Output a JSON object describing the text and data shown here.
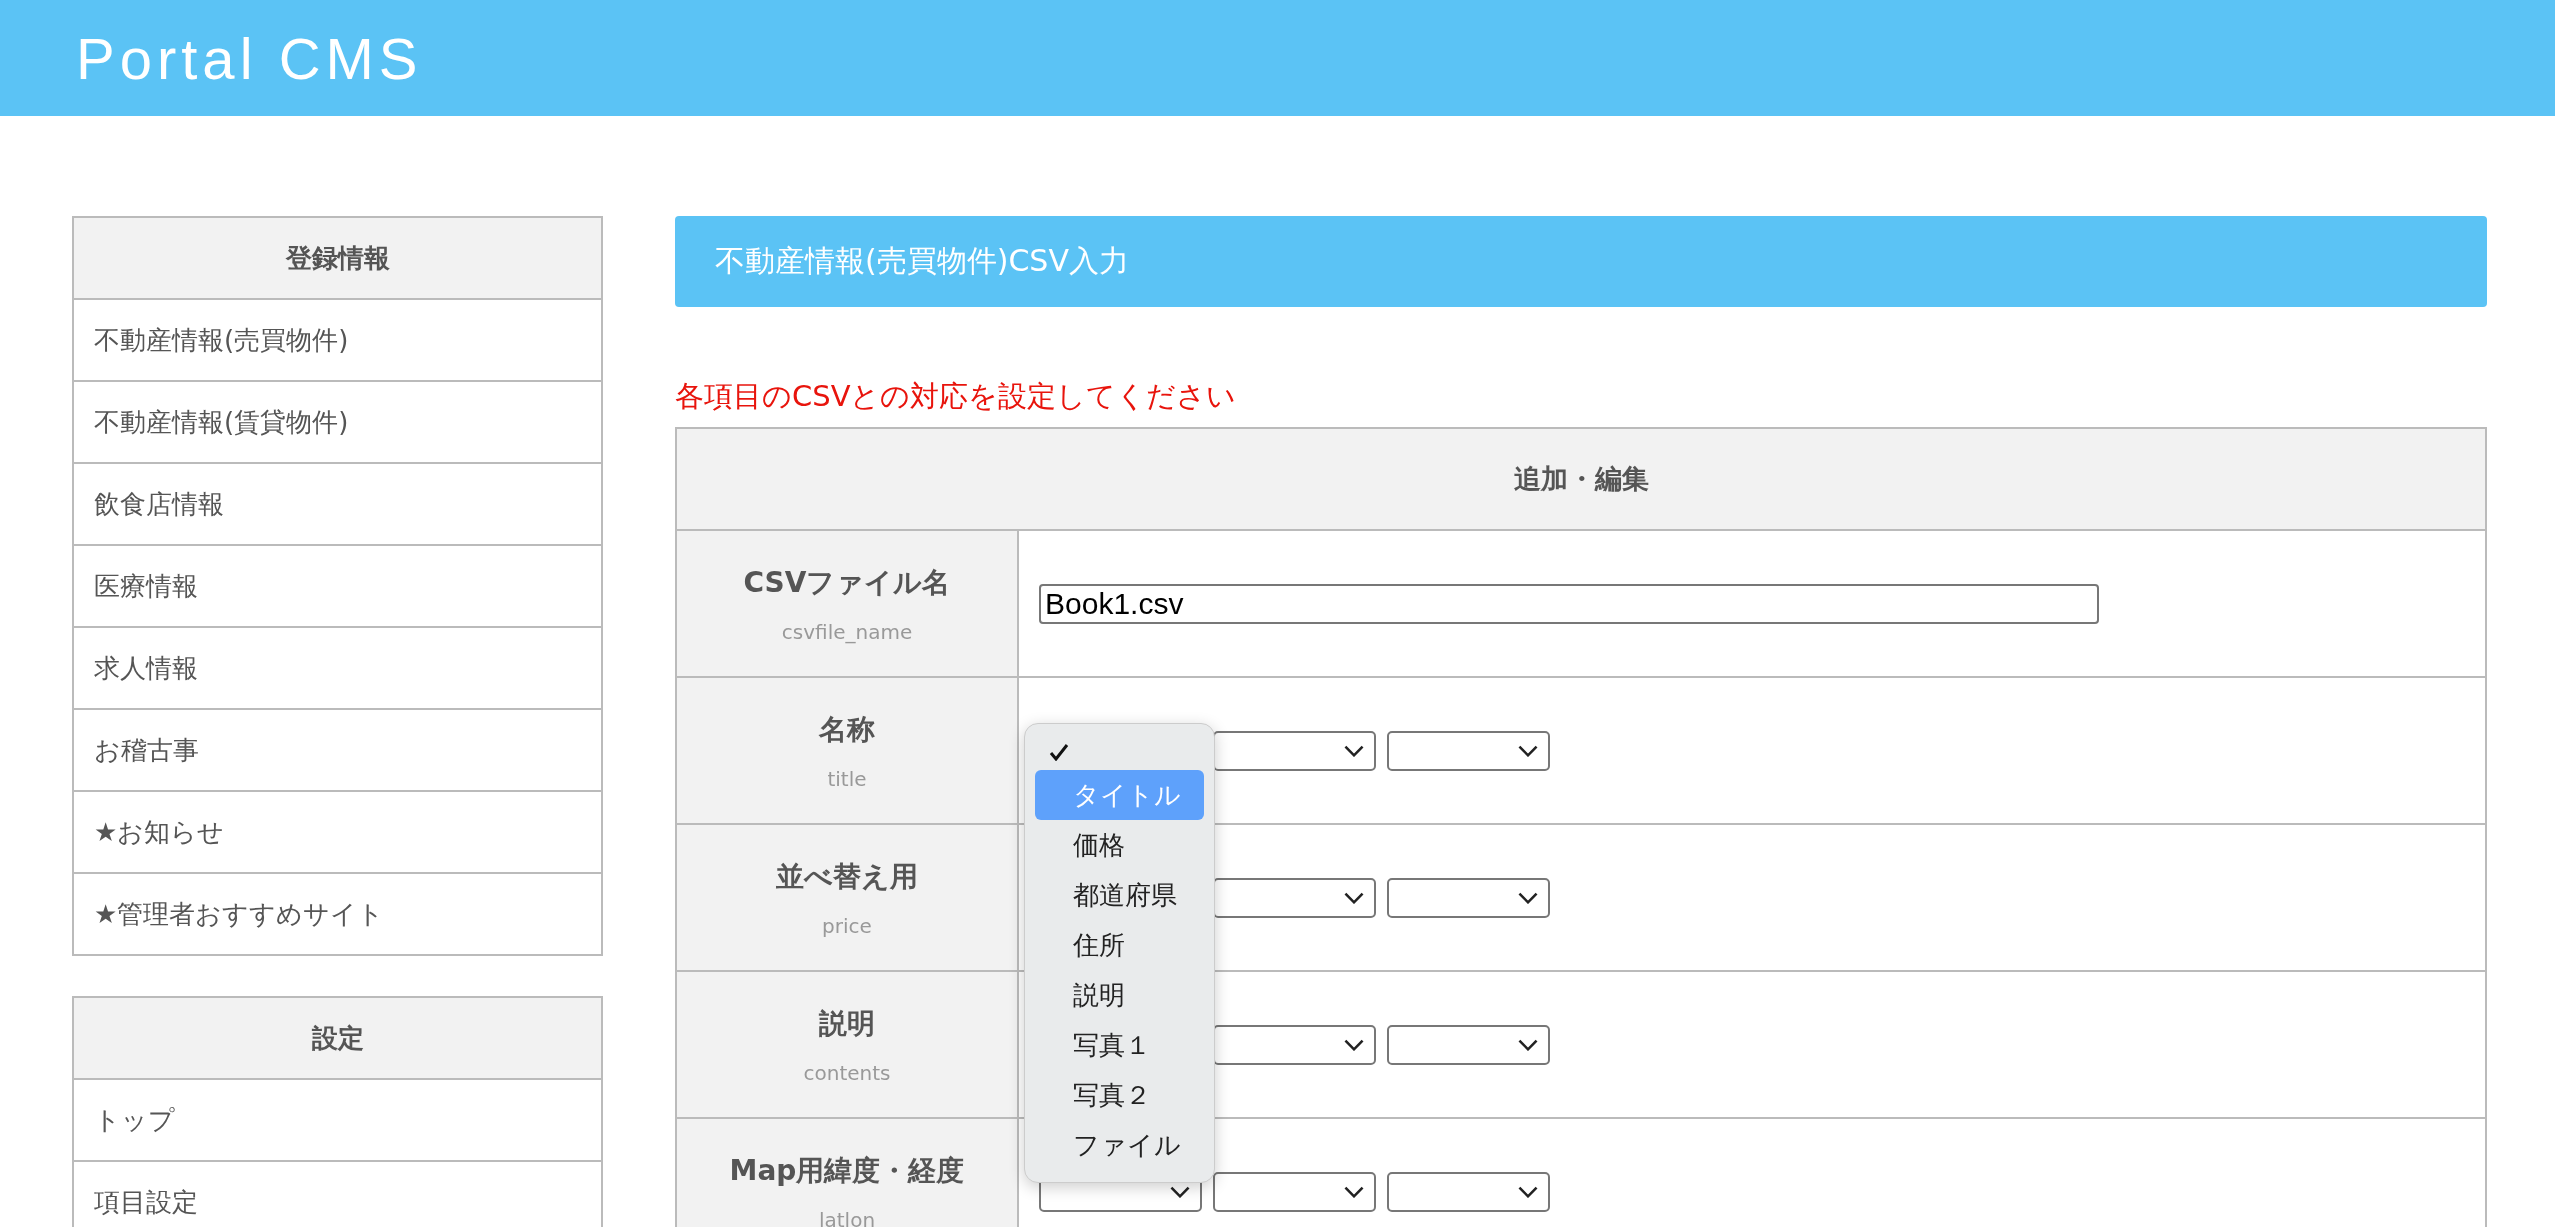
{
  "header": {
    "title": "Portal CMS"
  },
  "sidebar": [
    {
      "heading": "登録情報",
      "items": [
        {
          "label": "不動産情報(売買物件)"
        },
        {
          "label": "不動産情報(賃貸物件)"
        },
        {
          "label": "飲食店情報"
        },
        {
          "label": "医療情報"
        },
        {
          "label": "求人情報"
        },
        {
          "label": "お稽古事"
        },
        {
          "label": "★お知らせ"
        },
        {
          "label": "★管理者おすすめサイト"
        }
      ]
    },
    {
      "heading": "設定",
      "items": [
        {
          "label": "トップ"
        },
        {
          "label": "項目設定"
        }
      ]
    }
  ],
  "main": {
    "title": "不動産情報(売買物件)CSV入力",
    "notice": "各項目のCSVとの対応を設定してください",
    "table": {
      "heading": "追加・編集",
      "rows": [
        {
          "kind": "text",
          "label": "CSVファイル名",
          "key": "csvfile_name",
          "value": "Book1.csv"
        },
        {
          "kind": "selects",
          "label": "名称",
          "key": "title",
          "selects": [
            {
              "kind": "select"
            },
            {
              "kind": "select"
            }
          ]
        },
        {
          "kind": "selects",
          "label": "並べ替え用",
          "key": "price",
          "selects": [
            {
              "kind": "select"
            },
            {
              "kind": "select"
            }
          ]
        },
        {
          "kind": "selects",
          "label": "説明",
          "key": "contents",
          "selects": [
            {
              "kind": "select"
            },
            {
              "kind": "select"
            }
          ]
        },
        {
          "kind": "selects",
          "label": "Map用緯度・経度",
          "key": "latlon",
          "selects": [
            {
              "kind": "select"
            },
            {
              "kind": "select"
            },
            {
              "kind": "select"
            }
          ]
        }
      ]
    },
    "dropdown": {
      "blank_checked": true,
      "options": [
        {
          "label": "タイトル",
          "selected": true
        },
        {
          "label": "価格",
          "selected": false
        },
        {
          "label": "都道府県",
          "selected": false
        },
        {
          "label": "住所",
          "selected": false
        },
        {
          "label": "説明",
          "selected": false
        },
        {
          "label": "写真１",
          "selected": false
        },
        {
          "label": "写真２",
          "selected": false
        },
        {
          "label": "ファイル",
          "selected": false
        }
      ]
    }
  }
}
